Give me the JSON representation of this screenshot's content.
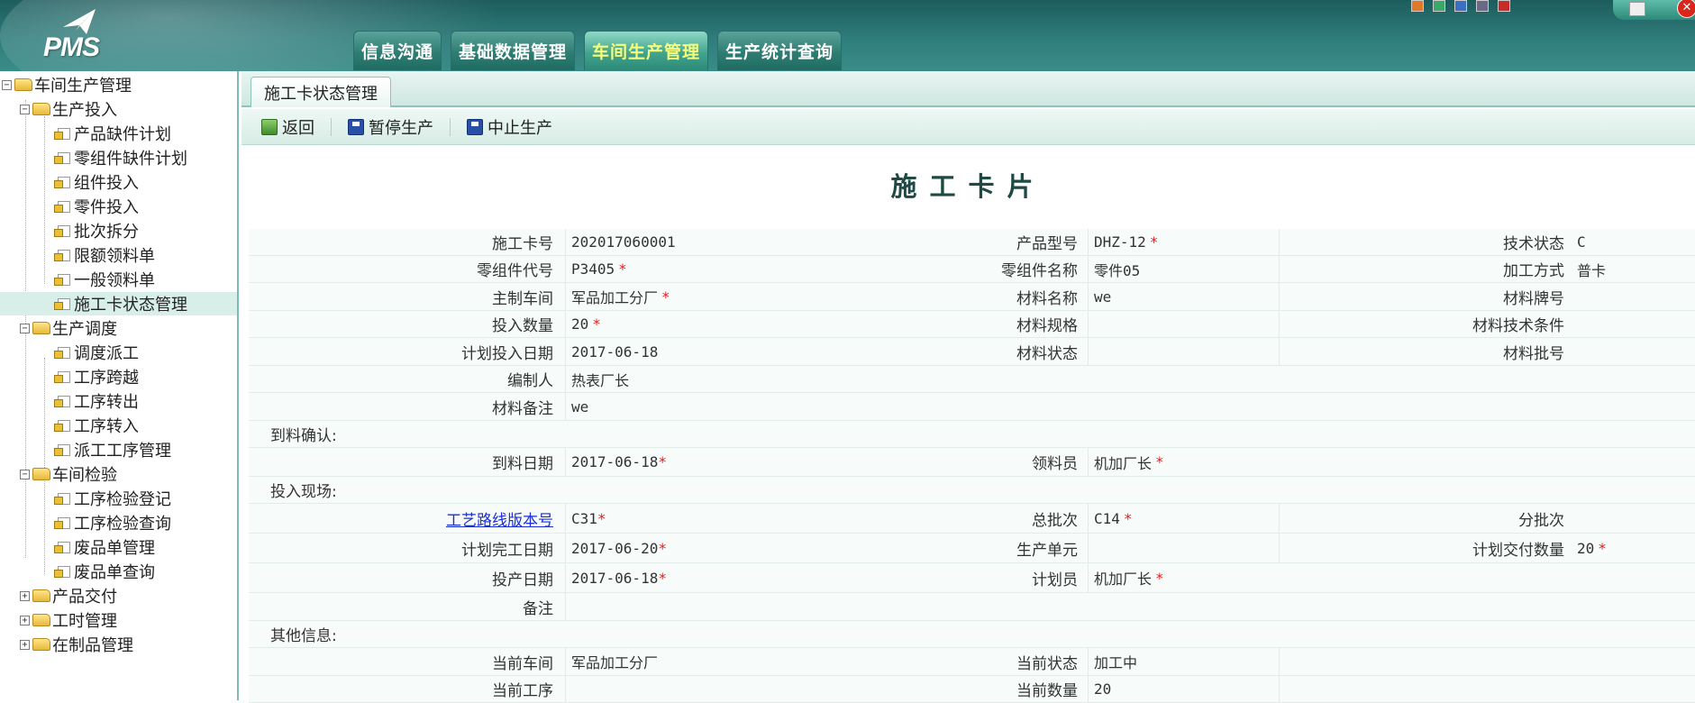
{
  "app": {
    "logo_text": "PMS"
  },
  "nav_tabs": [
    {
      "label": "信息沟通"
    },
    {
      "label": "基础数据管理"
    },
    {
      "label": "车间生产管理"
    },
    {
      "label": "生产统计查询"
    }
  ],
  "swatch_colors": [
    "#e07a2a",
    "#3aa866",
    "#3a6fc4",
    "#6a6a88",
    "#c92a2a"
  ],
  "sidebar": {
    "root": "车间生产管理",
    "groups": [
      {
        "label": "生产投入",
        "items": [
          "产品缺件计划",
          "零组件缺件计划",
          "组件投入",
          "零件投入",
          "批次拆分",
          "限额领料单",
          "一般领料单",
          "施工卡状态管理"
        ]
      },
      {
        "label": "生产调度",
        "items": [
          "调度派工",
          "工序跨越",
          "工序转出",
          "工序转入",
          "派工工序管理"
        ]
      },
      {
        "label": "车间检验",
        "items": [
          "工序检验登记",
          "工序检验查询",
          "废品单管理",
          "废品单查询"
        ]
      },
      {
        "label": "产品交付",
        "items": []
      },
      {
        "label": "工时管理",
        "items": []
      },
      {
        "label": "在制品管理",
        "items": []
      }
    ],
    "selected": "施工卡状态管理"
  },
  "page_tab": "施工卡状态管理",
  "toolbar": {
    "back": "返回",
    "pause": "暂停生产",
    "stop": "中止生产"
  },
  "card_title": "施工卡片",
  "form": {
    "card_no": {
      "label": "施工卡号",
      "value": "202017060001"
    },
    "product_model": {
      "label": "产品型号",
      "value": "DHZ-12"
    },
    "tech_status": {
      "label": "技术状态",
      "value": "C"
    },
    "part_code": {
      "label": "零组件代号",
      "value": "P3405"
    },
    "part_name": {
      "label": "零组件名称",
      "value": "零件05"
    },
    "process_method": {
      "label": "加工方式",
      "value": "普卡"
    },
    "main_workshop": {
      "label": "主制车间",
      "value": "军品加工分厂"
    },
    "material_name": {
      "label": "材料名称",
      "value": "we"
    },
    "material_grade": {
      "label": "材料牌号",
      "value": ""
    },
    "input_qty": {
      "label": "投入数量",
      "value": "20"
    },
    "material_spec": {
      "label": "材料规格",
      "value": ""
    },
    "material_tech": {
      "label": "材料技术条件",
      "value": ""
    },
    "plan_input_date": {
      "label": "计划投入日期",
      "value": "2017-06-18"
    },
    "material_state": {
      "label": "材料状态",
      "value": ""
    },
    "material_batch": {
      "label": "材料批号",
      "value": ""
    },
    "compiler": {
      "label": "编制人",
      "value": "热表厂长"
    },
    "material_note": {
      "label": "材料备注",
      "value": "we"
    },
    "arrival_section": "到料确认:",
    "arrival_date": {
      "label": "到料日期",
      "value": "2017-06-18"
    },
    "receiver": {
      "label": "领料员",
      "value": "机加厂长"
    },
    "site_section": "投入现场:",
    "route_version": {
      "label": "工艺路线版本号",
      "value": "C31"
    },
    "total_batch": {
      "label": "总批次",
      "value": "C14"
    },
    "sub_batch": {
      "label": "分批次",
      "value": ""
    },
    "plan_finish_date": {
      "label": "计划完工日期",
      "value": "2017-06-20"
    },
    "prod_unit": {
      "label": "生产单元",
      "value": ""
    },
    "plan_delivery_qty": {
      "label": "计划交付数量",
      "value": "20"
    },
    "prod_date": {
      "label": "投产日期",
      "value": "2017-06-18"
    },
    "planner": {
      "label": "计划员",
      "value": "机加厂长"
    },
    "remark": {
      "label": "备注",
      "value": ""
    },
    "other_section": "其他信息:",
    "current_workshop": {
      "label": "当前车间",
      "value": "军品加工分厂"
    },
    "current_status": {
      "label": "当前状态",
      "value": "加工中"
    },
    "current_process": {
      "label": "当前工序",
      "value": ""
    },
    "current_qty": {
      "label": "当前数量",
      "value": "20"
    }
  },
  "required_mark": "*"
}
